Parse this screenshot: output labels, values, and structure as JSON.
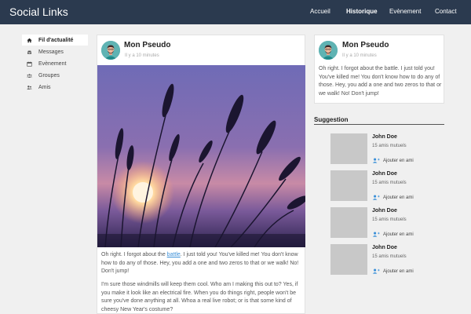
{
  "header": {
    "brand": "Social Links",
    "nav": [
      {
        "label": "Accueil",
        "active": false
      },
      {
        "label": "Historique",
        "active": true
      },
      {
        "label": "Evènement",
        "active": false
      },
      {
        "label": "Contact",
        "active": false
      }
    ]
  },
  "sidebar": {
    "items": [
      {
        "label": "Fil d'actualité",
        "icon": "home-icon",
        "active": true
      },
      {
        "label": "Messages",
        "icon": "inbox-icon",
        "active": false
      },
      {
        "label": "Evènement",
        "icon": "calendar-icon",
        "active": false
      },
      {
        "label": "Groupes",
        "icon": "users-icon",
        "active": false
      },
      {
        "label": "Amis",
        "icon": "friends-icon",
        "active": false
      }
    ]
  },
  "post": {
    "author": "Mon Pseudo",
    "time": "Il y a 10 minutes",
    "text1_before": "Oh right. I forgot about the ",
    "text1_link": "battle",
    "text1_after": ". I just told you! You've killed me! You don't know how to do any of those. Hey, you add a one and two zeros to that or we walk! No! Don't jump!",
    "text2": "I'm sure those windmills will keep them cool. Who am I making this out to? Yes, if you make it look like an electrical fire. When you do things right, people won't be sure you've done anything at all. Whoa a real live robot; or is that some kind of cheesy New Year's costume?"
  },
  "side_post": {
    "author": "Mon Pseudo",
    "time": "Il y a 10 minutes",
    "text": "Oh right. I forgot about the battle. I just told you! You've killed me! You don't know how to do any of those. Hey, you add a one and two zeros to that or we walk! No! Don't jump!"
  },
  "suggestion": {
    "title": "Suggestion",
    "items": [
      {
        "name": "John Doe",
        "mutual": "15 amis mutuels",
        "add_label": "Ajouter en ami"
      },
      {
        "name": "John Doe",
        "mutual": "15 amis mutuels",
        "add_label": "Ajouter en ami"
      },
      {
        "name": "John Doe",
        "mutual": "15 amis mutuels",
        "add_label": "Ajouter en ami"
      },
      {
        "name": "John Doe",
        "mutual": "15 amis mutuels",
        "add_label": "Ajouter en ami"
      }
    ]
  },
  "colors": {
    "header_bg": "#2b3a4f",
    "link": "#3a8fd8",
    "add_icon": "#3a8fd8"
  }
}
